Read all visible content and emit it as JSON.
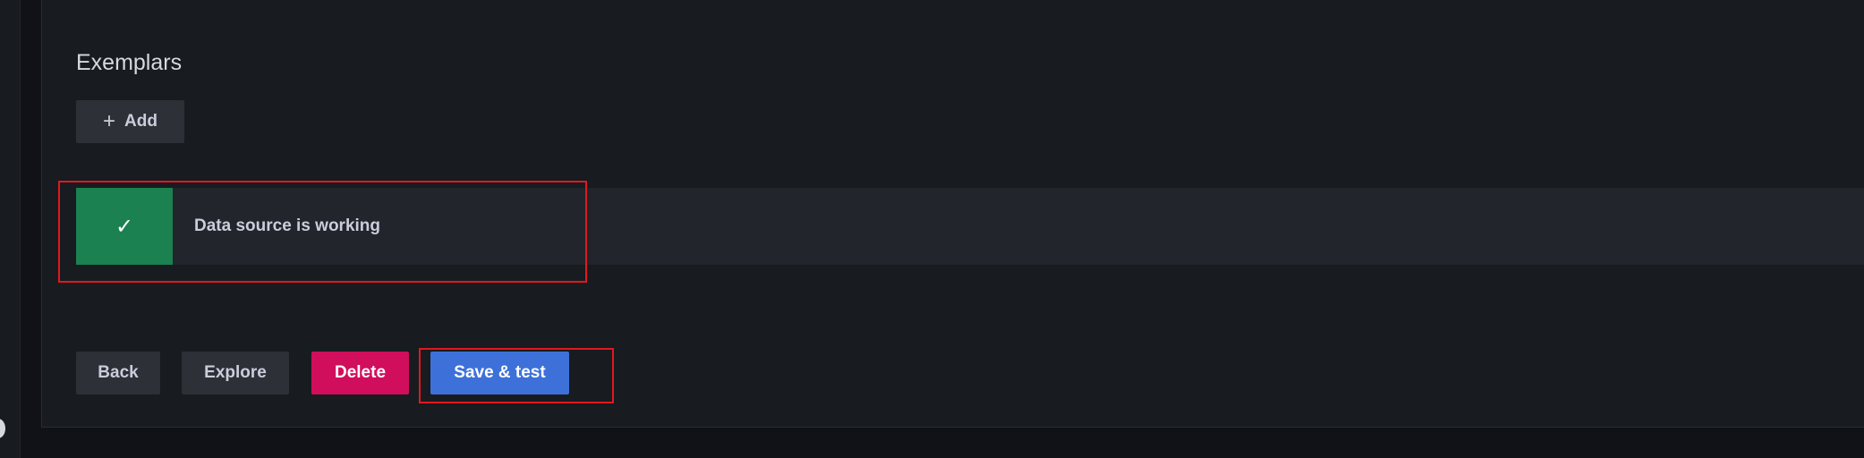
{
  "section": {
    "title": "Exemplars",
    "add_label": "Add",
    "add_icon": "plus-icon"
  },
  "alert": {
    "message": "Data source is working",
    "icon": "check-icon",
    "color": "#1b8150"
  },
  "actions": {
    "back": "Back",
    "explore": "Explore",
    "delete": "Delete",
    "save_test": "Save & test"
  },
  "colors": {
    "delete": "#d10e5c",
    "primary": "#3d71d9",
    "highlight": "#e0191f"
  }
}
